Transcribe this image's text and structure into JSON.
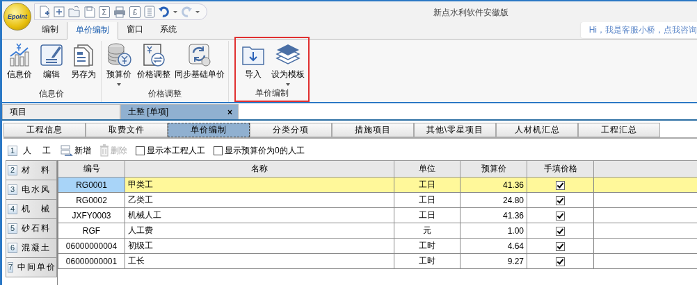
{
  "window": {
    "title": "新点水利软件安徽版",
    "logo": "Epoint"
  },
  "quick_access": [
    {
      "kind": "new"
    },
    {
      "kind": "add"
    },
    {
      "kind": "open"
    },
    {
      "kind": "save"
    },
    {
      "kind": "glyph",
      "glyph": "Σ"
    },
    {
      "kind": "print"
    },
    {
      "kind": "glyph",
      "glyph": "£"
    },
    {
      "kind": "calc"
    },
    {
      "kind": "undo",
      "disabled": false
    },
    {
      "kind": "redo",
      "disabled": true
    }
  ],
  "ribbon_tabs": [
    {
      "label": "编制",
      "selected": false
    },
    {
      "label": "单价编制",
      "selected": true
    },
    {
      "label": "窗口",
      "selected": false
    },
    {
      "label": "系统",
      "selected": false
    }
  ],
  "chat_bubble": "Hi，我是客服小桥，点我咨询",
  "ribbon_groups": [
    {
      "label": "信息价",
      "highlighted": false,
      "buttons": [
        {
          "label": "信息价",
          "dropdown": false
        },
        {
          "label": "编辑",
          "dropdown": false
        },
        {
          "label": "另存为",
          "dropdown": false
        }
      ]
    },
    {
      "label": "价格调整",
      "highlighted": false,
      "buttons": [
        {
          "label": "预算价",
          "dropdown": true
        },
        {
          "label": "价格调整",
          "dropdown": false
        },
        {
          "label": "同步基础单价",
          "dropdown": false
        }
      ]
    },
    {
      "label": "单价编制",
      "highlighted": true,
      "buttons": [
        {
          "label": "导入",
          "dropdown": false
        },
        {
          "label": "设为模板",
          "dropdown": true
        }
      ]
    }
  ],
  "doc_tabs": [
    {
      "label": "项目",
      "selected": false
    },
    {
      "label": "土整 [单项]",
      "selected": true,
      "close": "×"
    }
  ],
  "page_tabs": [
    {
      "label": "工程信息",
      "selected": false
    },
    {
      "label": "取费文件",
      "selected": false
    },
    {
      "label": "单价编制",
      "selected": true
    },
    {
      "label": "分类分项",
      "selected": false
    },
    {
      "label": "措施项目",
      "selected": false
    },
    {
      "label": "其他\\零星项目",
      "selected": false
    },
    {
      "label": "人材机汇总",
      "selected": false
    },
    {
      "label": "工程汇总",
      "selected": false
    }
  ],
  "current_category": {
    "number": "1",
    "label": "人　工"
  },
  "toolbar": [
    {
      "kind": "button",
      "label": "新增",
      "disabled": false
    },
    {
      "kind": "button",
      "label": "删除",
      "disabled": true
    },
    {
      "kind": "checkbox",
      "label": "显示本工程人工",
      "checked": false
    },
    {
      "kind": "checkbox",
      "label": "显示预算价为0的人工",
      "checked": false
    }
  ],
  "categories": [
    {
      "number": "2",
      "label": "材　料"
    },
    {
      "number": "3",
      "label": "电水风"
    },
    {
      "number": "4",
      "label": "机　械"
    },
    {
      "number": "5",
      "label": "砂石料"
    },
    {
      "number": "6",
      "label": "混凝土"
    },
    {
      "number": "7",
      "label": "中间单价"
    }
  ],
  "table": {
    "columns": [
      "编号",
      "名称",
      "单位",
      "预算价",
      "手填价格"
    ],
    "rows": [
      {
        "code": "RG0001",
        "name": "甲类工",
        "unit": "工日",
        "price": "41.36",
        "manual": true,
        "selected": true
      },
      {
        "code": "RG0002",
        "name": "乙类工",
        "unit": "工日",
        "price": "24.80",
        "manual": true,
        "selected": false
      },
      {
        "code": "JXFY0003",
        "name": "机械人工",
        "unit": "工日",
        "price": "41.36",
        "manual": true,
        "selected": false
      },
      {
        "code": "RGF",
        "name": "人工费",
        "unit": "元",
        "price": "1.00",
        "manual": true,
        "selected": false
      },
      {
        "code": "06000000004",
        "name": "初级工",
        "unit": "工时",
        "price": "4.64",
        "manual": true,
        "selected": false
      },
      {
        "code": "06000000001",
        "name": "工长",
        "unit": "工时",
        "price": "9.27",
        "manual": true,
        "selected": false
      }
    ]
  }
}
